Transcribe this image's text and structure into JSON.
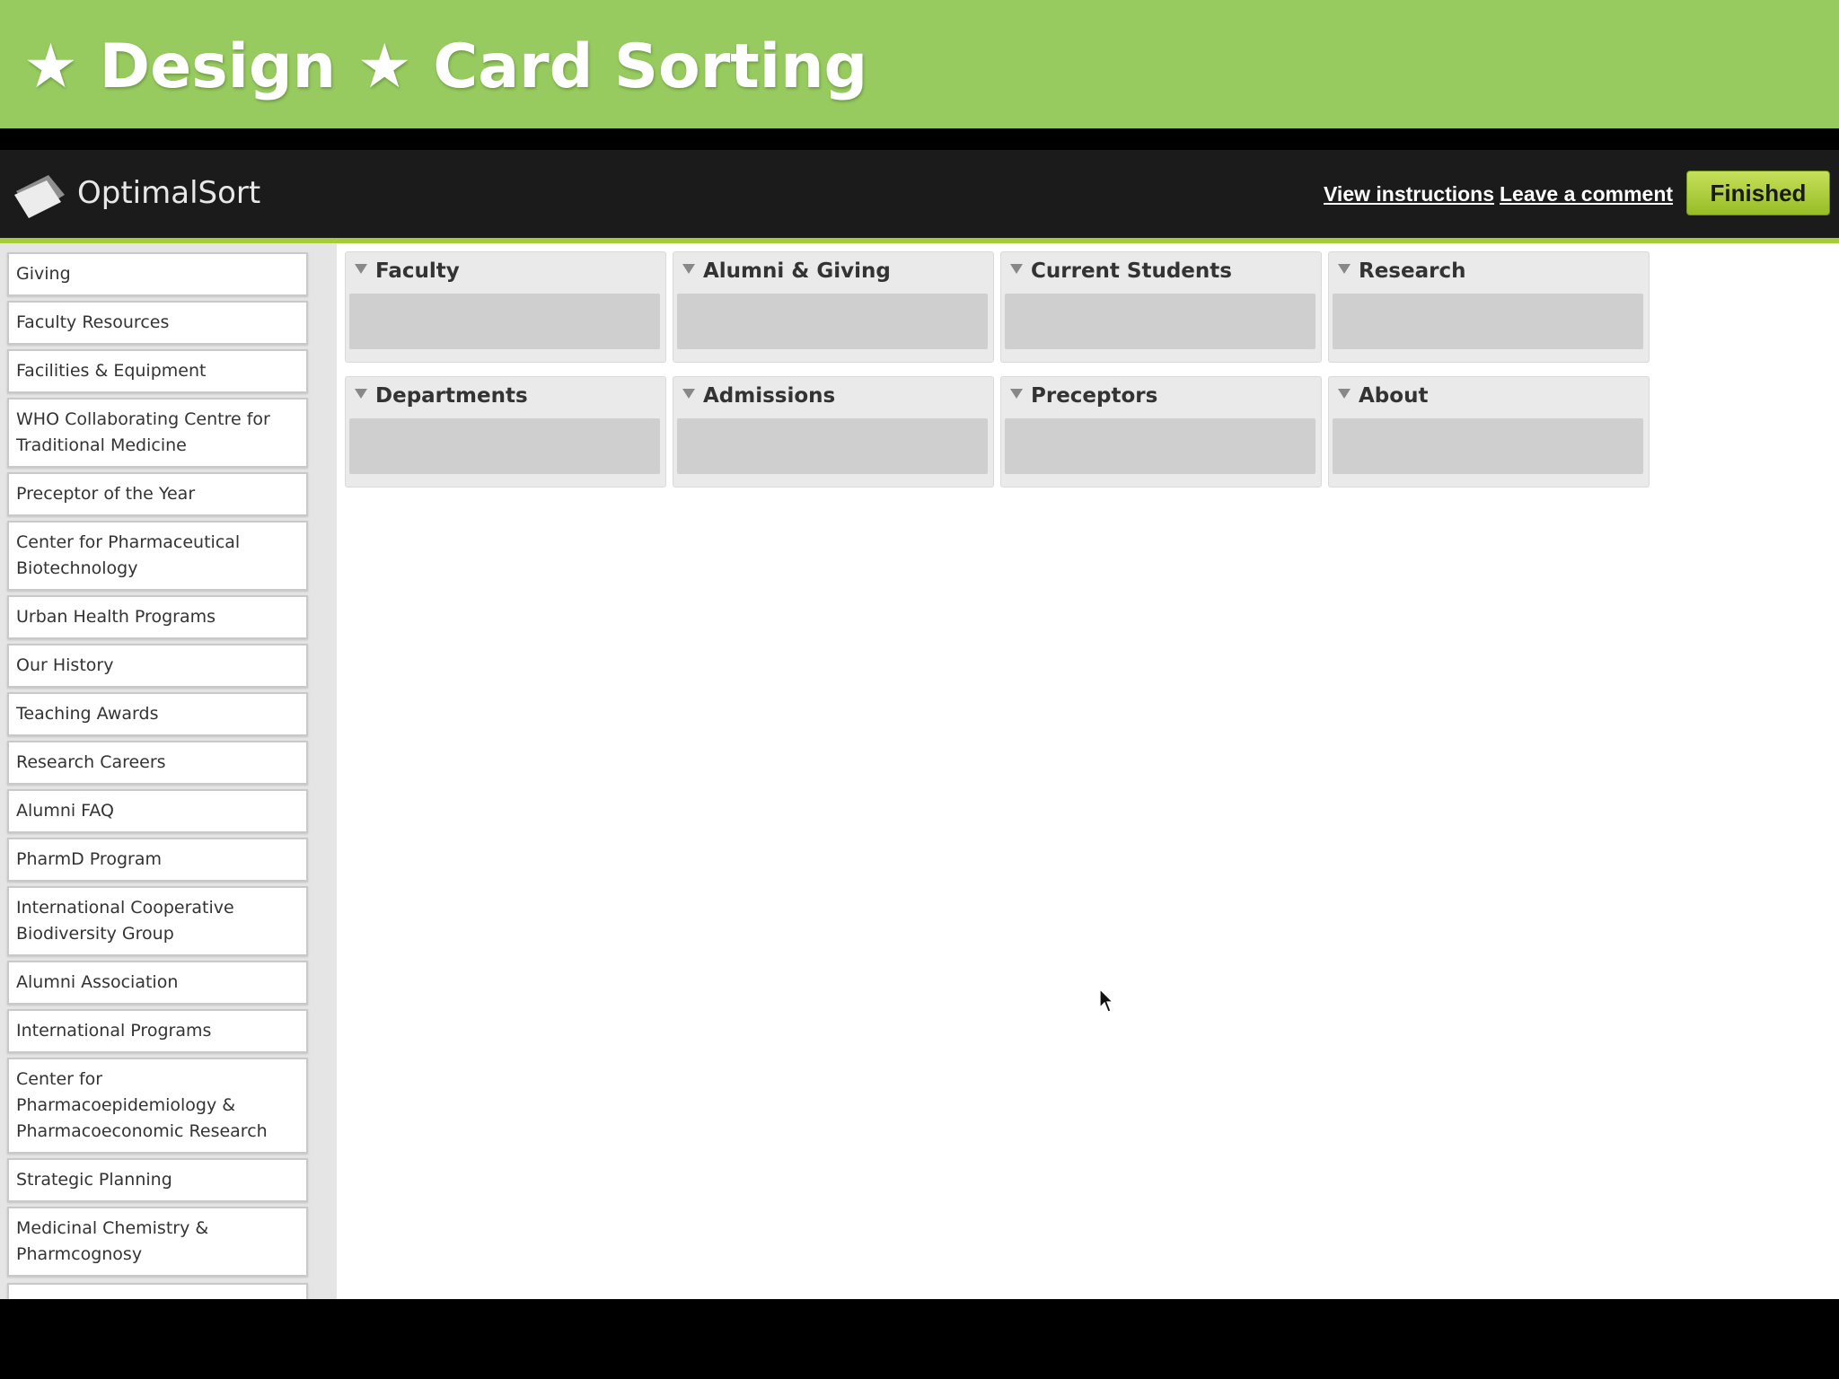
{
  "slide": {
    "title": "★ Design ★ Card Sorting"
  },
  "app": {
    "logo_text": "OptimalSort",
    "view_instructions": "View instructions",
    "leave_comment": "Leave a comment",
    "finished": "Finished"
  },
  "cards": [
    "Giving",
    "Faculty Resources",
    "Facilities & Equipment",
    "WHO Collaborating Centre for Traditional Medicine",
    "Preceptor of the Year",
    "Center for Pharmaceutical Biotechnology",
    "Urban Health Programs",
    "Our History",
    "Teaching Awards",
    "Research Careers",
    "Alumni FAQ",
    "PharmD Program",
    "International Cooperative Biodiversity Group",
    "Alumni Association",
    "International Programs",
    "Center for Pharmacoepidemiology & Pharmacoeconomic Research",
    "Strategic Planning",
    "Medicinal Chemistry & Pharmcognosy"
  ],
  "categories": [
    "Faculty",
    "Alumni & Giving",
    "Current Students",
    "Research",
    "Departments",
    "Admissions",
    "Preceptors",
    "About"
  ],
  "colors": {
    "header_green": "#97cb5f",
    "accent_lime": "#a5cc3a"
  }
}
